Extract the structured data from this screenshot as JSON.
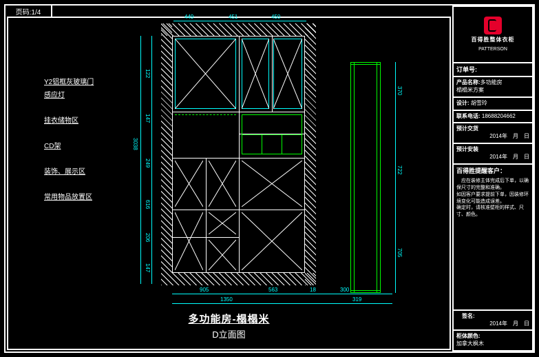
{
  "page_indicator": "页码:1/4",
  "title": {
    "main": "多功能房-榻榻米",
    "sub": "D立面图"
  },
  "labels": {
    "l1": "Y2铝框灰玻璃门",
    "l2": "感应灯",
    "l3": "挂衣储物区",
    "l4": "CD架",
    "l5": "装饰、展示区",
    "l6": "常用物品放置区"
  },
  "dims": {
    "top_a": "449",
    "top_b": "451",
    "top_c": "450",
    "left_v1": "122",
    "left_v2": "147",
    "left_v3": "3038",
    "left_v4": "249",
    "left_v5": "616",
    "left_v6": "206",
    "left_v7": "147",
    "bot_a": "905",
    "bot_b": "563",
    "bot_c": "18",
    "bot_d": "1350",
    "bot_e": "300",
    "bot_f": "319",
    "r_v1": "370",
    "r_v2": "722",
    "r_v3": "705"
  },
  "panel": {
    "brand1": "百得胜整体衣柜",
    "brand2": "PATTERSON",
    "order_lbl": "订单号:",
    "prod_lbl": "产品名称:",
    "prod_val": "多功能房\n榻榻米方案",
    "designer_lbl": "设计:",
    "designer_val": "胡雪玲",
    "phone_lbl": "联系电话:",
    "phone_val": "18688204662",
    "delivery_lbl": "预计交货",
    "date_tpl": "2014年　月　日",
    "install_lbl": "预计安装",
    "reminder_title": "百得胜提醒客户：",
    "reminder_body": "应在装修主体完成后下单，以确保尺寸的完整和准确。\n如因客户要求提前下单，因装修环境变化可能造成误差。\n确定时，请核准壁柜的样式、尺寸、颜色。",
    "sign_lbl": "签名:",
    "color_lbl": "柜体颜色:",
    "color_val": "加拿大枫木"
  }
}
